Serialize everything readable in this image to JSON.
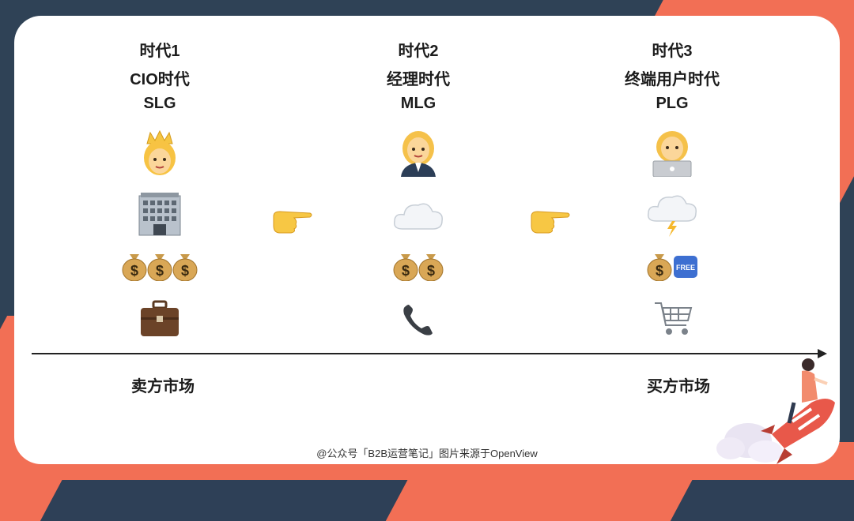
{
  "eras": [
    {
      "era": "时代1",
      "name": "CIO时代",
      "model": "SLG"
    },
    {
      "era": "时代2",
      "name": "经理时代",
      "model": "MLG"
    },
    {
      "era": "时代3",
      "name": "终端用户时代",
      "model": "PLG"
    }
  ],
  "markets": {
    "left": "卖方市场",
    "right": "买方市场"
  },
  "footer": "@公众号「B2B运营笔记」图片来源于OpenView",
  "icons": {
    "era1": [
      "queen-icon",
      "office-building-icon",
      "money-bag-icon",
      "briefcase-icon"
    ],
    "era2": [
      "manager-woman-icon",
      "cloud-icon",
      "money-bag-icon",
      "telephone-icon"
    ],
    "era3": [
      "woman-laptop-icon",
      "storm-cloud-icon",
      "money-free-icon",
      "shopping-cart-icon"
    ]
  },
  "colors": {
    "navy": "#2f4256",
    "orange": "#f26f55",
    "card": "#ffffff"
  }
}
